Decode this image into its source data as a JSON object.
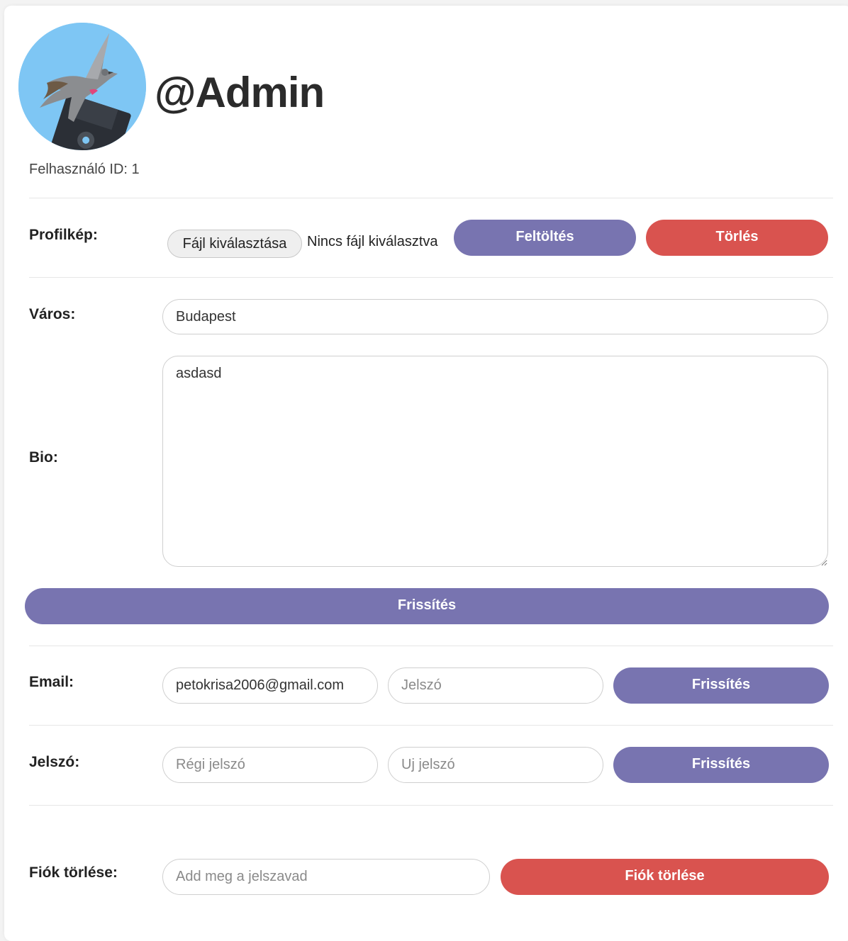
{
  "profile": {
    "username": "@Admin",
    "user_id_text": "Felhasználó ID: 1"
  },
  "profile_picture": {
    "label": "Profilkép:",
    "choose_file_label": "Fájl kiválasztása",
    "no_file_text": "Nincs fájl kiválasztva",
    "upload_label": "Feltöltés",
    "delete_label": "Törlés"
  },
  "city": {
    "label": "Város:",
    "value": "Budapest"
  },
  "bio": {
    "label": "Bio:",
    "value": "asdasd",
    "update_label": "Frissítés"
  },
  "email": {
    "label": "Email:",
    "value": "petokrisa2006@gmail.com",
    "password_placeholder": "Jelszó",
    "update_label": "Frissítés"
  },
  "password": {
    "label": "Jelszó:",
    "old_placeholder": "Régi jelszó",
    "new_placeholder": "Uj jelszó",
    "update_label": "Frissítés"
  },
  "delete_account": {
    "label": "Fiók törlése:",
    "password_placeholder": "Add meg a jelszavad",
    "button_label": "Fiók törlése"
  },
  "colors": {
    "primary_button": "#7874b0",
    "danger_button": "#d9534f",
    "avatar_background": "#7ec6f4"
  }
}
